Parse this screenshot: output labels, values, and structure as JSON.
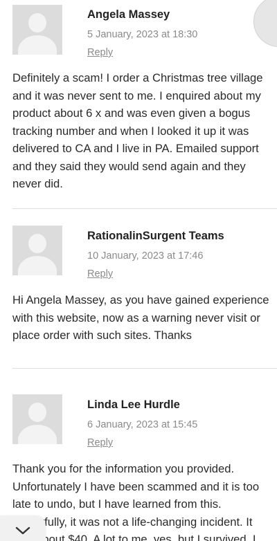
{
  "comments": [
    {
      "author": "Angela Massey",
      "date": "5 January, 2023 at 18:30",
      "reply_label": "Reply",
      "lines": [
        "Definitely a scam! I order a Christmas tree village",
        "and it was never sent to me. I enquired about my",
        "product about 6 x and was even given a bogus",
        "tracking number and when I looked it up it was",
        "delivered to CA and I live in PA. Emailed support",
        "and they said they would send again and they",
        "never did."
      ]
    },
    {
      "author": "RationalinSurgent Teams",
      "date": "10 January, 2023 at 17:46",
      "reply_label": "Reply",
      "lines": [
        "Hi Angela Massey, as you have gained experience",
        "with this website, now as a warning never visit or",
        "place order with such sites. Thanks"
      ]
    },
    {
      "author": "Linda Lee Hurdle",
      "date": "6 January, 2023 at 15:45",
      "reply_label": "Reply",
      "lines": [
        "Thank you for the information you provided.",
        "Unfortunately I have been scammed and it is too",
        "late to undo, but I have learned from this.",
        "Thankfully, it was not a life-changing incident. It",
        "was about $40. A lot to me, yes, but I survived. I"
      ]
    }
  ],
  "icons": {
    "collapse": "chevron-down-icon",
    "avatar": "default-avatar-icon"
  }
}
